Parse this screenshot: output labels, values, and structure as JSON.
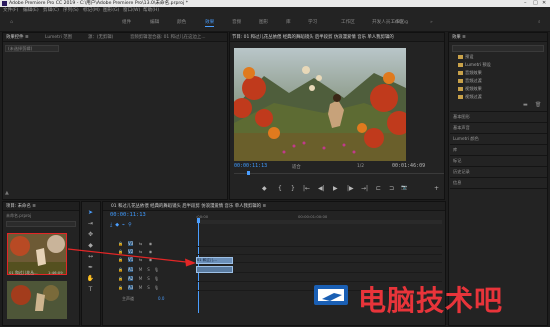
{
  "window": {
    "title": "Adobe Premiere Pro CC 2019 - C:\\用户\\Adobe Premiere Pro\\13.0\\未命名.prproj *"
  },
  "menu": {
    "items": [
      "文件(F)",
      "编辑(E)",
      "剪辑(C)",
      "序列(S)",
      "标记(M)",
      "图形(G)",
      "窗口(W)",
      "帮助(H)"
    ]
  },
  "workspaces": {
    "items": [
      "组件",
      "编辑",
      "颜色",
      "效果",
      "音频",
      "图形",
      "库",
      "学习",
      "工作区",
      "开发人员工作区",
      "Editing"
    ],
    "active": "效果"
  },
  "source_panel": {
    "tabs": [
      "效果控件 ≡",
      "Lumetri 范围",
      "源：(无剪辑)",
      "音频剪辑混合器: 01 和过儿在这边上..."
    ],
    "dropdown": "(未选择剪辑)",
    "footer": "▲"
  },
  "program_monitor": {
    "tab": "节目: 01 和过儿花丛依偎 经典的舞蹈镜头 后半段剪 仿浪漫爱情 音乐 单人我剪辑的",
    "timecode": "00:00:11:13",
    "fit": "适合",
    "zoom": "1/2",
    "duration": "00:01:46:09",
    "controls": [
      "◆",
      "{",
      "}",
      "|←",
      "◀|",
      "▶",
      "|▶",
      "→|",
      "⊏",
      "⊐",
      "📷",
      "+"
    ]
  },
  "project_panel": {
    "title": "项目: 未命名 ≡",
    "file": "未命名.prproj",
    "clips": [
      {
        "name": "01 和过儿花丛...",
        "duration": "1:46:09"
      },
      {
        "name": "",
        "duration": ""
      }
    ]
  },
  "timeline": {
    "tab": "01 和过儿花丛依偎 经典的舞蹈镜头 后半段剪 仿浪漫爱情 音乐 单人我剪辑的 ≡",
    "timecode": "00:00:11:13",
    "ruler_start": ":00:00",
    "ruler_mid": "00:00:01:00:00",
    "tracks": [
      {
        "label": "V3",
        "type": "video"
      },
      {
        "label": "V2",
        "type": "video"
      },
      {
        "label": "V1",
        "type": "video"
      },
      {
        "label": "A1",
        "type": "audio"
      },
      {
        "label": "A2",
        "type": "audio"
      },
      {
        "label": "A3",
        "type": "audio"
      }
    ],
    "master": "主声道",
    "master_value": "0.0",
    "clip_video_label": "01 和过儿...",
    "clip_audio_label": ""
  },
  "effects_panel": {
    "title": "效果 ≡",
    "items": [
      "预设",
      "Lumetri 预设",
      "音频效果",
      "音频过渡",
      "视频效果",
      "视频过渡"
    ]
  },
  "side_panels": [
    "基本图形",
    "基本声音",
    "Lumetri 颜色",
    "库",
    "标记",
    "历史记录",
    "信息"
  ],
  "watermark": {
    "text": "电脑技术吧"
  },
  "colors": {
    "accent": "#4a9eff",
    "panel_bg": "#232323",
    "annotation_red": "#e32626"
  }
}
